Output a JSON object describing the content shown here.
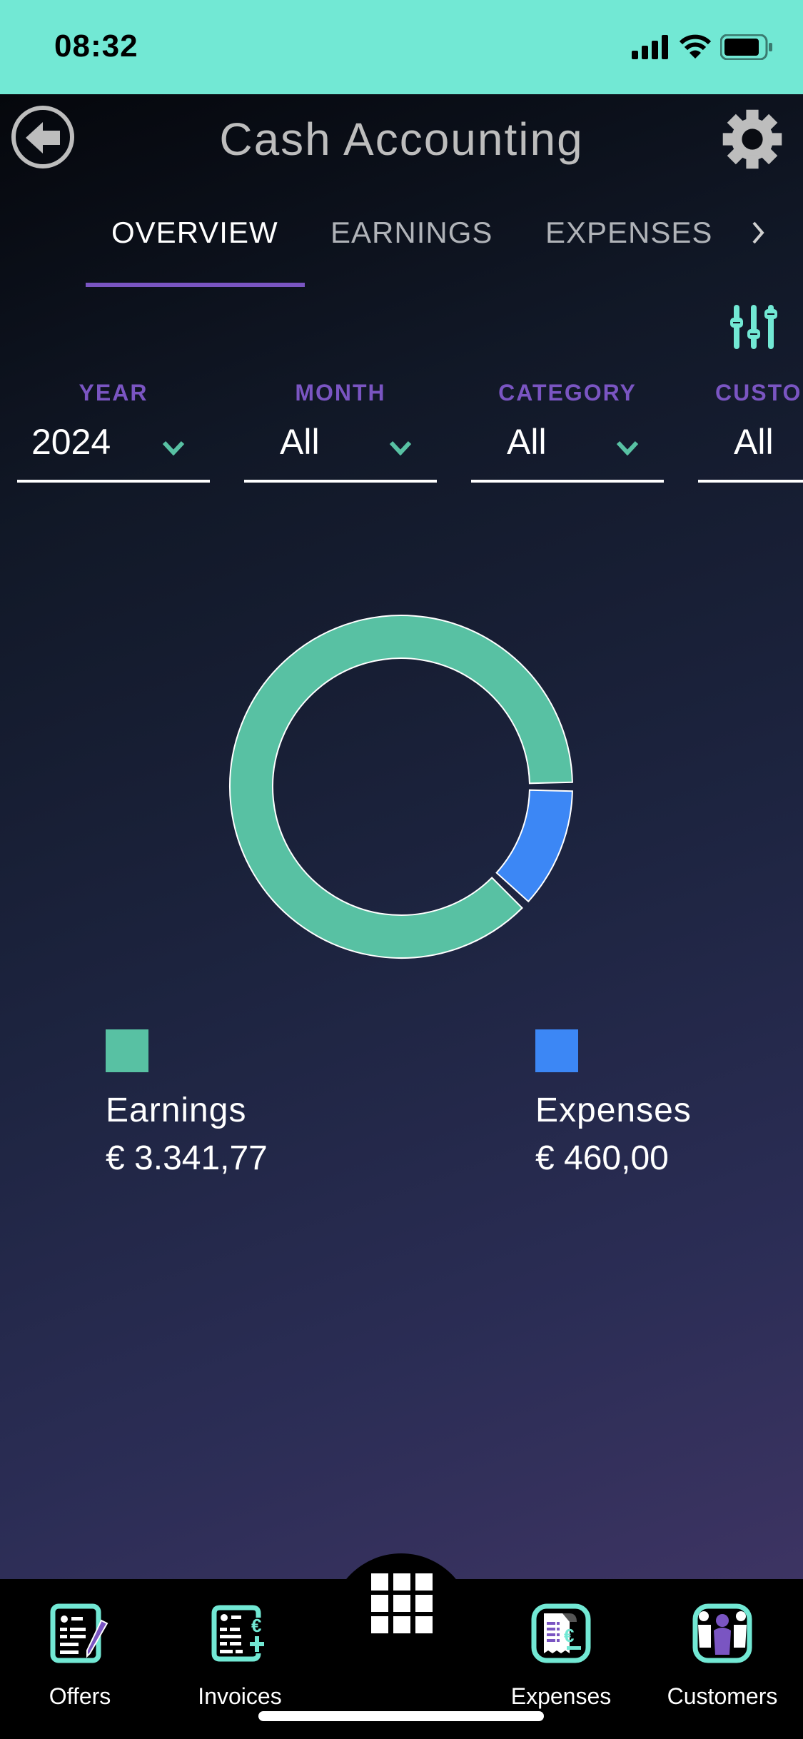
{
  "status_bar": {
    "time": "08:32",
    "icons": [
      "signal-icon",
      "wifi-icon",
      "battery-icon"
    ]
  },
  "header": {
    "title": "Cash Accounting",
    "back_icon": "back-arrow-icon",
    "settings_icon": "gear-icon"
  },
  "tabs": [
    {
      "label": "OVERVIEW",
      "active": true
    },
    {
      "label": "EARNINGS",
      "active": false
    },
    {
      "label": "EXPENSES",
      "active": false
    }
  ],
  "filters": [
    {
      "label": "YEAR",
      "value": "2024"
    },
    {
      "label": "MONTH",
      "value": "All"
    },
    {
      "label": "CATEGORY",
      "value": "All"
    },
    {
      "label": "CUSTO",
      "value": "All"
    }
  ],
  "colors": {
    "accent": "#72e8d4",
    "purple": "#7a55c2",
    "earnings": "#58c1a3",
    "expenses": "#3c87f5"
  },
  "chart_data": {
    "type": "pie",
    "variant": "donut",
    "categories": [
      "Earnings",
      "Expenses"
    ],
    "values": [
      3341.77,
      460.0
    ],
    "colors": [
      "#58c1a3",
      "#3c87f5"
    ],
    "legend": "bottom"
  },
  "legend": [
    {
      "label": "Earnings",
      "value": "€ 3.341,77"
    },
    {
      "label": "Expenses",
      "value": "€ 460,00"
    }
  ],
  "bottom_nav": [
    {
      "label": "Offers",
      "icon": "offers-icon"
    },
    {
      "label": "Invoices",
      "icon": "invoices-icon"
    },
    {
      "label": "",
      "icon": "grid-menu-icon"
    },
    {
      "label": "Expenses",
      "icon": "expenses-icon"
    },
    {
      "label": "Customers",
      "icon": "customers-icon"
    }
  ]
}
